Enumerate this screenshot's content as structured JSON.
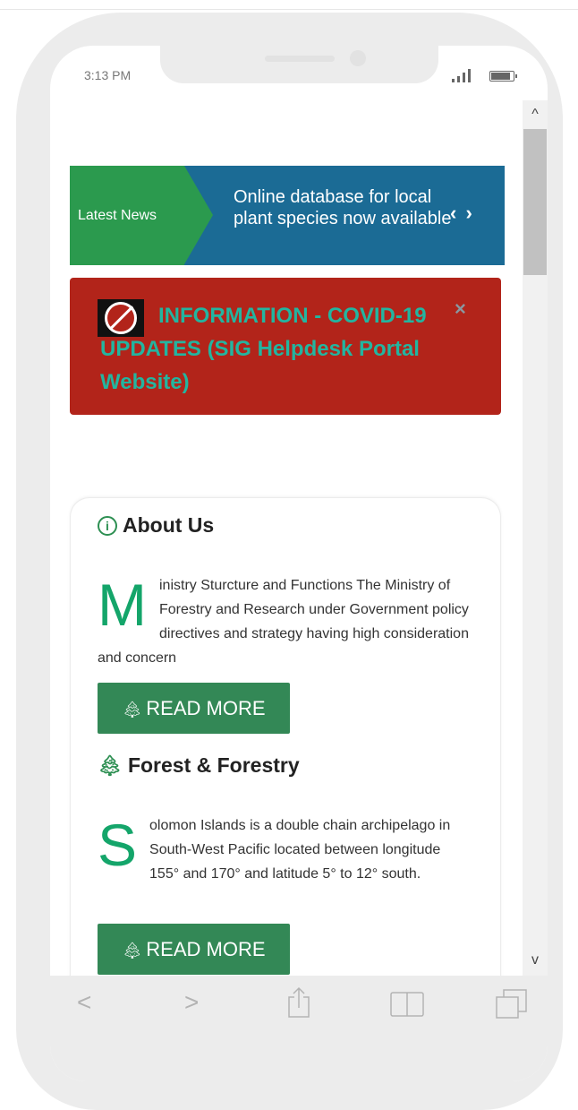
{
  "status_bar": {
    "time": "3:13 PM"
  },
  "news_ticker": {
    "label": "Latest News",
    "headline": "Online database for local plant species now available",
    "prev_glyph": "‹",
    "next_glyph": "›"
  },
  "alert": {
    "title": "INFORMATION - COVID-19 UPDATES (SIG Helpdesk Portal Website)",
    "close_glyph": "×",
    "colors": {
      "background": "#b2241a",
      "text": "#23b5a0"
    }
  },
  "about": {
    "heading": "About Us",
    "icon": "info-circle-icon",
    "dropcap": "M",
    "body": "inistry Sturcture and Functions The Ministry of Forestry and Research under Government policy directives and strategy having high consideration and concern",
    "button_label": "READ MORE"
  },
  "forest": {
    "heading": "Forest & Forestry",
    "icon": "tree-icon",
    "dropcap": "S",
    "body": "olomon Islands is a double chain archipelago in South-West Pacific located between longitude 155° and 170° and latitude 5° to 12° south.",
    "button_label": "READ MORE"
  },
  "scrollbar": {
    "up_glyph": "^",
    "down_glyph": "v"
  },
  "toolbar": {
    "back_glyph": "<",
    "forward_glyph": ">",
    "icons": [
      "back-icon",
      "forward-icon",
      "share-icon",
      "bookmarks-icon",
      "tabs-icon"
    ]
  },
  "colors": {
    "ticker_label": "#2b9a4e",
    "ticker_background": "#1b6b95",
    "button": "#338856",
    "dropcap": "#14a56a"
  }
}
